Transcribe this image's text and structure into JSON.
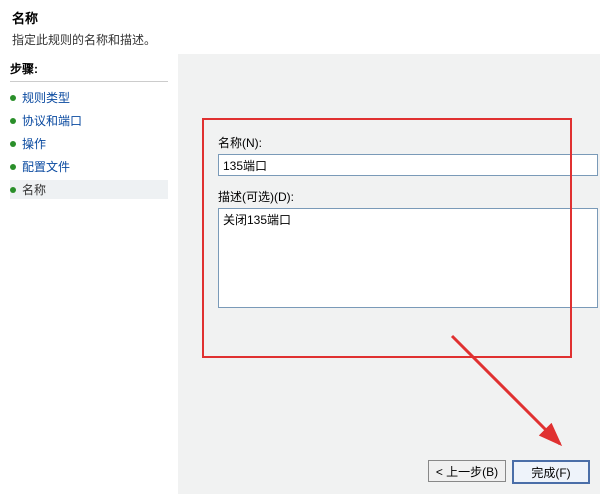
{
  "header": {
    "title": "名称",
    "subtitle": "指定此规则的名称和描述。"
  },
  "sidebar": {
    "steps_label": "步骤:",
    "items": [
      {
        "label": "规则类型",
        "current": false
      },
      {
        "label": "协议和端口",
        "current": false
      },
      {
        "label": "操作",
        "current": false
      },
      {
        "label": "配置文件",
        "current": false
      },
      {
        "label": "名称",
        "current": true
      }
    ]
  },
  "form": {
    "name_label": "名称(N):",
    "name_value": "135端口",
    "desc_label": "描述(可选)(D):",
    "desc_value": "关闭135端口"
  },
  "buttons": {
    "back": "< 上一步(B)",
    "finish": "完成(F)"
  }
}
